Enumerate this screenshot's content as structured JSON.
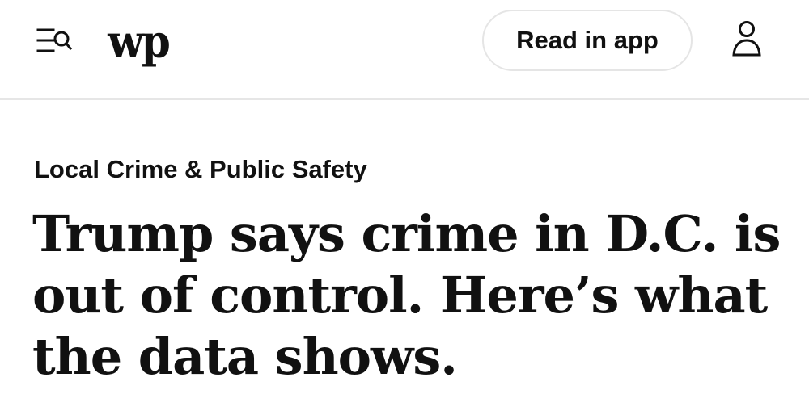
{
  "header": {
    "menu_search_icon": "menu-search-icon",
    "logo_text": "wp",
    "read_in_app_label": "Read in app",
    "profile_icon": "person-icon"
  },
  "article": {
    "section_kicker": "Local Crime & Public Safety",
    "headline": "Trump says crime in D.C. is out of control. Here’s what the data shows."
  },
  "colors": {
    "text": "#111111",
    "border": "#e6e6e6",
    "background": "#ffffff"
  }
}
